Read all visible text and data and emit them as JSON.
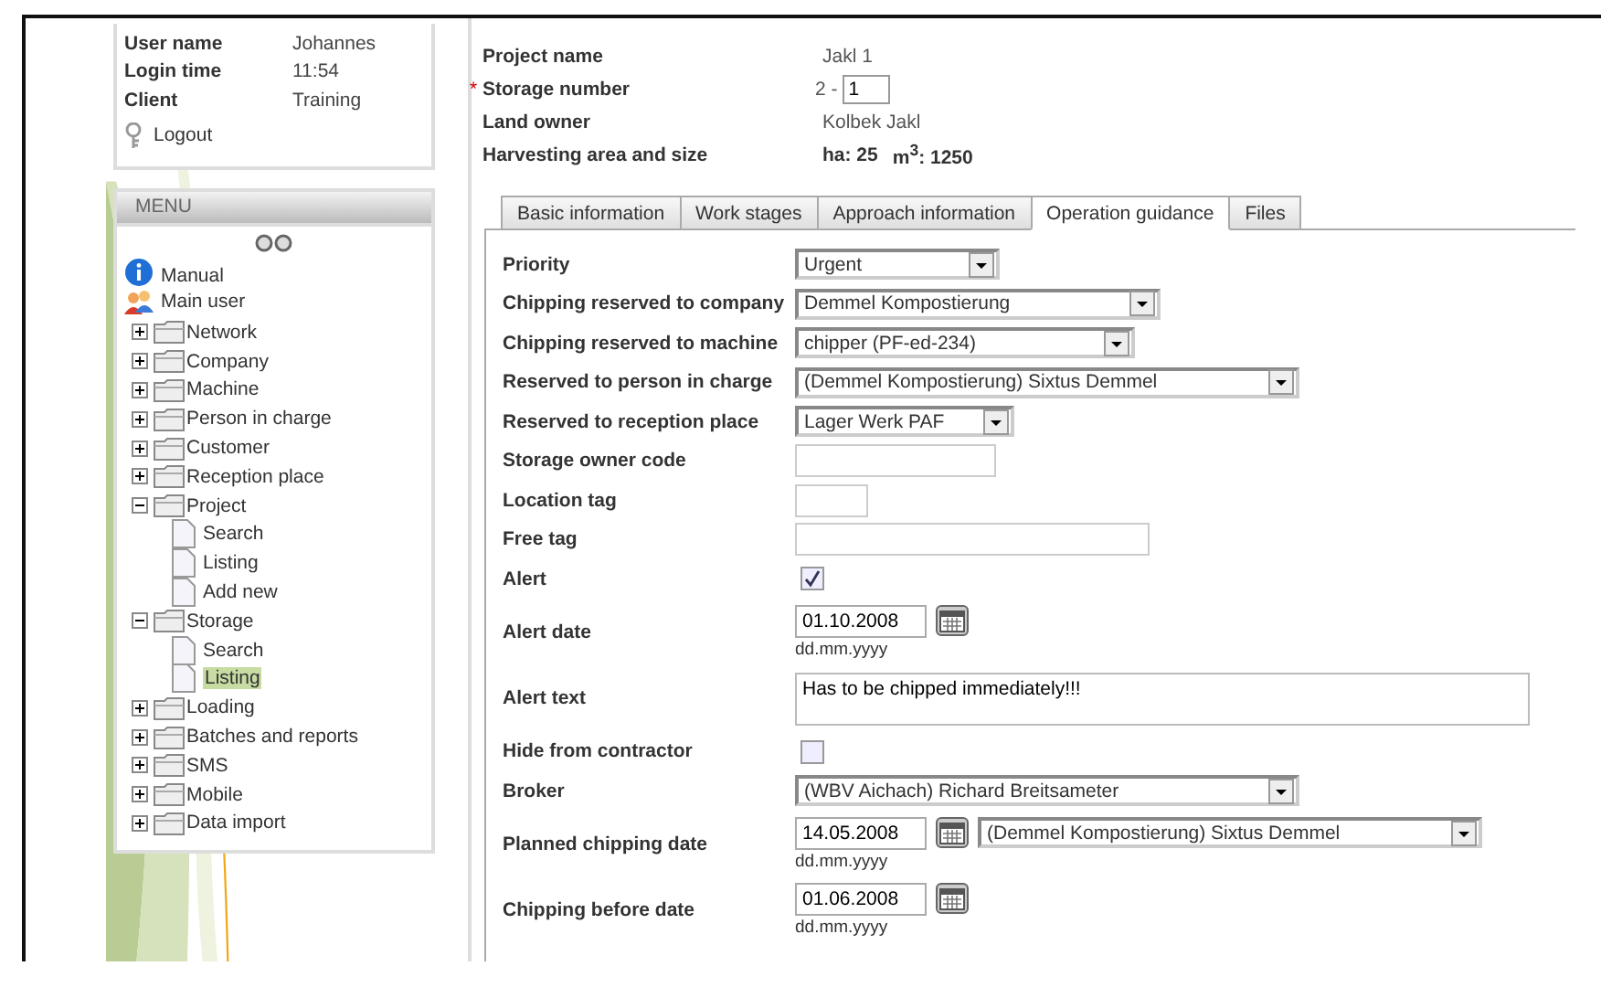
{
  "user_info": [
    {
      "label": "User name",
      "value": "Johannes"
    },
    {
      "label": "Login time",
      "value": "11:54"
    },
    {
      "label": "Client",
      "value": "Training"
    }
  ],
  "logout": "Logout",
  "menu": {
    "title": "MENU",
    "links": [
      {
        "kind": "info",
        "label": "Manual"
      },
      {
        "kind": "users",
        "label": "Main user"
      }
    ],
    "tree": [
      {
        "label": "Network",
        "expanded": false
      },
      {
        "label": "Company",
        "expanded": false
      },
      {
        "label": "Machine",
        "expanded": false
      },
      {
        "label": "Person in charge",
        "expanded": false
      },
      {
        "label": "Customer",
        "expanded": false
      },
      {
        "label": "Reception place",
        "expanded": false
      },
      {
        "label": "Project",
        "expanded": true,
        "children": [
          {
            "label": "Search",
            "selected": false
          },
          {
            "label": "Listing",
            "selected": false
          },
          {
            "label": "Add new",
            "selected": false
          }
        ]
      },
      {
        "label": "Storage",
        "expanded": true,
        "children": [
          {
            "label": "Search",
            "selected": false
          },
          {
            "label": "Listing",
            "selected": true
          }
        ]
      },
      {
        "label": "Loading",
        "expanded": false
      },
      {
        "label": "Batches and reports",
        "expanded": false
      },
      {
        "label": "SMS",
        "expanded": false
      },
      {
        "label": "Mobile",
        "expanded": false
      },
      {
        "label": "Data import",
        "expanded": false
      }
    ]
  },
  "header": [
    {
      "kind": "text",
      "label": "Project name",
      "value": "Jakl 1"
    },
    {
      "kind": "input",
      "marker": "*",
      "label": "Storage number",
      "prefix": "2 -",
      "value": "1"
    },
    {
      "kind": "text",
      "label": "Land owner",
      "value": "Kolbek Jakl"
    },
    {
      "kind": "area",
      "label": "Harvesting area and size",
      "value": "ha: 25",
      "value_2": "m$^{3}$: 1250"
    }
  ],
  "tabs": [
    {
      "label": "Basic information",
      "selected": false
    },
    {
      "label": "Work stages",
      "selected": false
    },
    {
      "label": "Approach information",
      "selected": false
    },
    {
      "label": "Operation guidance",
      "selected": true
    },
    {
      "label": "Files",
      "selected": false
    }
  ],
  "form": [
    {
      "kind": "select",
      "label": "Priority",
      "value": "Urgent"
    },
    {
      "kind": "select",
      "label": "Chipping reserved to company",
      "value": "Demmel Kompostierung"
    },
    {
      "kind": "select",
      "label": "Chipping reserved to machine",
      "value": "chipper (PF-ed-234)"
    },
    {
      "kind": "select",
      "label": "Reserved to person in charge",
      "value": "(Demmel Kompostierung) Sixtus Demmel"
    },
    {
      "kind": "select",
      "label": "Reserved to reception place",
      "value": "Lager Werk PAF"
    },
    {
      "kind": "input",
      "label": "Storage owner code"
    },
    {
      "kind": "input",
      "label": "Location tag"
    },
    {
      "kind": "input",
      "label": "Free tag"
    },
    {
      "kind": "checkbox",
      "label": "Alert",
      "checked": true
    },
    {
      "kind": "date",
      "label": "Alert date",
      "value": "01.10.2008",
      "hint": "dd.mm.yyyy"
    },
    {
      "kind": "textarea",
      "label": "Alert text",
      "value": "Has to be chipped immediately!!!"
    },
    {
      "kind": "checkbox",
      "label": "Hide from contractor",
      "checked": false
    },
    {
      "kind": "select",
      "label": "Broker",
      "value": "(WBV Aichach) Richard Breitsameter"
    },
    {
      "kind": "date_select",
      "label": "Planned chipping date",
      "value": "14.05.2008",
      "hint": "dd.mm.yyyy",
      "select_value": "(Demmel Kompostierung) Sixtus Demmel"
    },
    {
      "kind": "date",
      "label": "Chipping before date",
      "value": "01.06.2008",
      "hint": "dd.mm.yyyy"
    }
  ]
}
